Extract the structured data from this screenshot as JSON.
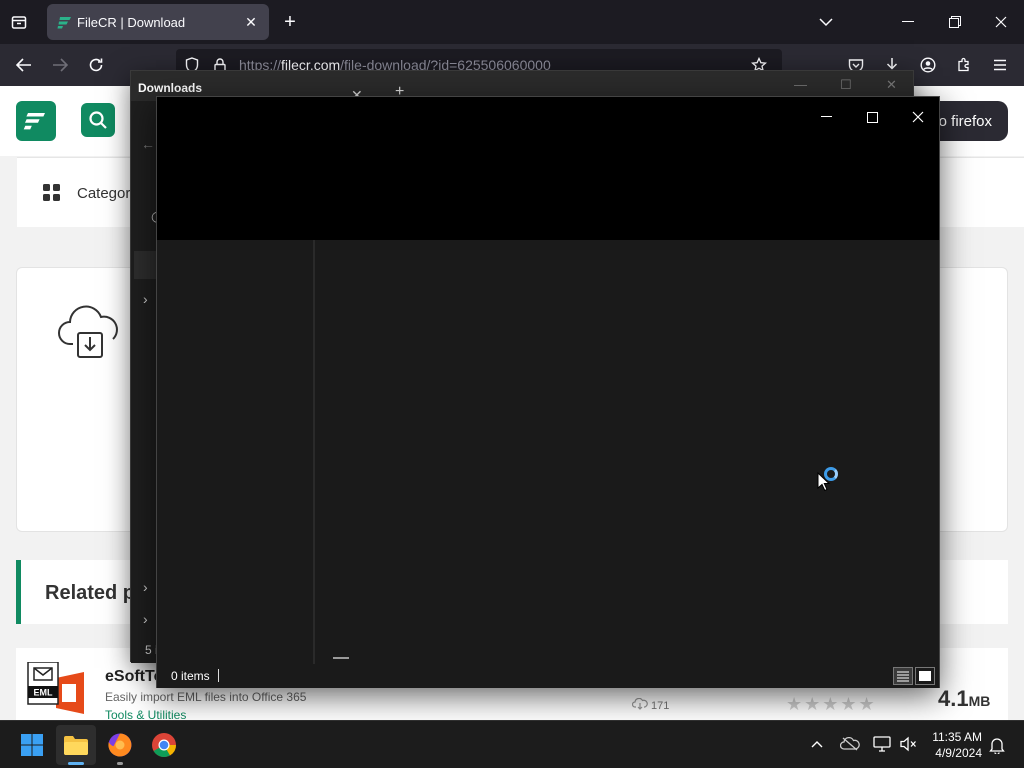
{
  "browser": {
    "tab": {
      "title": "FileCR | Download"
    },
    "url": {
      "prefix": "https://",
      "host": "filecr.com",
      "path": "/file-download/?id=625506060000"
    }
  },
  "site": {
    "firefox_button": "o firefox",
    "categories_label": "Categori",
    "related_title": "Related p",
    "product": {
      "name": "eSoftTo",
      "description": "Easily import EML files into Office 365",
      "category": "Tools & Utilities",
      "downloads": "171",
      "size_value": "4.1",
      "size_unit": "MB",
      "icon_badge": "EML"
    }
  },
  "explorer_bg": {
    "tab_label": "Downloads",
    "status": "5 i"
  },
  "explorer_fg": {
    "status_items": "0 items"
  },
  "taskbar": {
    "time": "11:35 AM",
    "date": "4/9/2024"
  },
  "colors": {
    "brand": "#108a61",
    "browser_dark": "#1c1b22",
    "spinner": "#3c9be8"
  }
}
